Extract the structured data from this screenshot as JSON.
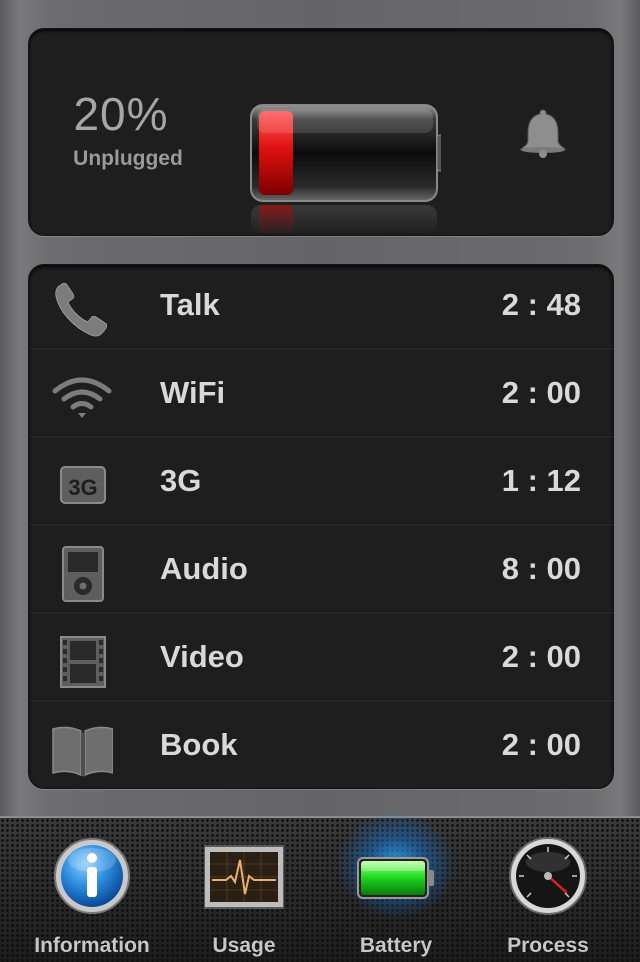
{
  "status": {
    "percent": "20%",
    "state": "Unplugged",
    "charge_level": 0.2,
    "charge_color": "#e01010"
  },
  "usage_list": [
    {
      "icon": "phone-icon",
      "label": "Talk",
      "value": "2 : 48"
    },
    {
      "icon": "wifi-icon",
      "label": "WiFi",
      "value": "2 : 00"
    },
    {
      "icon": "3g-icon",
      "label": "3G",
      "value": "1 : 12"
    },
    {
      "icon": "ipod-icon",
      "label": "Audio",
      "value": "8 : 00"
    },
    {
      "icon": "film-icon",
      "label": "Video",
      "value": "2 : 00"
    },
    {
      "icon": "book-icon",
      "label": "Book",
      "value": "2 : 00"
    }
  ],
  "tabs": [
    {
      "icon": "info-icon",
      "label": "Information"
    },
    {
      "icon": "usage-monitor-icon",
      "label": "Usage"
    },
    {
      "icon": "battery-icon",
      "label": "Battery",
      "selected": true
    },
    {
      "icon": "speedometer-icon",
      "label": "Process"
    }
  ],
  "colors": {
    "accent_glow": "#28aaff",
    "tab_battery_fill": "#22dd22"
  }
}
